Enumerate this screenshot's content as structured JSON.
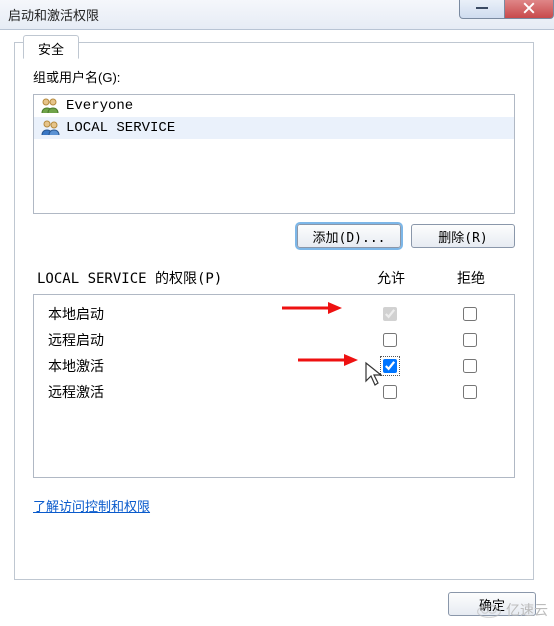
{
  "window": {
    "title": "启动和激活权限"
  },
  "tab": {
    "label": "安全"
  },
  "groupUsers": {
    "label": "组或用户名(G):",
    "items": [
      {
        "name": "Everyone",
        "icon": "group-icon"
      },
      {
        "name": "LOCAL SERVICE",
        "icon": "users-icon"
      }
    ]
  },
  "buttons": {
    "add": "添加(D)...",
    "remove": "删除(R)"
  },
  "permissions": {
    "headerLabel": "LOCAL SERVICE 的权限(P)",
    "allowLabel": "允许",
    "denyLabel": "拒绝",
    "rows": [
      {
        "label": "本地启动",
        "allow": true,
        "deny": false
      },
      {
        "label": "远程启动",
        "allow": false,
        "deny": false
      },
      {
        "label": "本地激活",
        "allow": true,
        "deny": false
      },
      {
        "label": "远程激活",
        "allow": false,
        "deny": false
      }
    ]
  },
  "link": {
    "text": "了解访问控制和权限"
  },
  "footer": {
    "ok": "确定"
  },
  "watermark": {
    "text": "亿速云"
  }
}
